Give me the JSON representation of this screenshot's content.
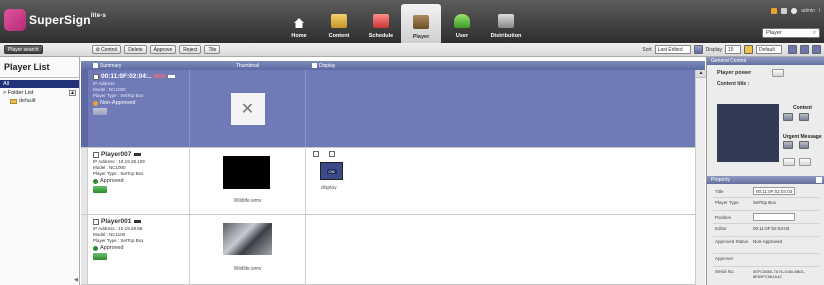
{
  "logo": {
    "text": "SuperSign",
    "suffix": "lite-s"
  },
  "nav": [
    {
      "label": "Home",
      "icon": "home-icon"
    },
    {
      "label": "Content",
      "icon": "content-icon"
    },
    {
      "label": "Schedule",
      "icon": "schedule-icon"
    },
    {
      "label": "Player",
      "icon": "player-icon"
    },
    {
      "label": "User",
      "icon": "user-icon"
    },
    {
      "label": "Distribution",
      "icon": "distribution-icon"
    }
  ],
  "header_right": {
    "user": "admin",
    "search_value": "Player"
  },
  "toolbar": {
    "player_search": "Player search",
    "control": "Control",
    "delete": "Delete",
    "approve": "Approve",
    "reject": "Reject",
    "tile": "Tile",
    "sort_label": "Sort",
    "sort_value": "Last Edited",
    "display_label": "Display",
    "display_value": "15",
    "view_value": "Default"
  },
  "sidebar": {
    "title": "Player List",
    "all": "All",
    "folder_list": "> Folder List",
    "folder_default": "default"
  },
  "columns": {
    "summary": "Summary",
    "thumbnail": "Thumbnail",
    "display": "Display"
  },
  "players": [
    {
      "name": "00:11:0F:02:04:..",
      "badge": "NEW",
      "ip": "IP Address",
      "model": "Model : NC1000",
      "type": "Player Type : SetTop Box",
      "status": "Non-Approved"
    },
    {
      "name": "Player007",
      "ip": "IP Address : 10.19.28.109",
      "model": "Model : NC1000",
      "type": "Player Type : SetTop Box",
      "status": "Approved",
      "file": "Wildlife.wmv",
      "display_label": "display",
      "display_button": "ON"
    },
    {
      "name": "Player001",
      "ip": "IP Address : 10.19.28.86",
      "model": "Model : NC1100",
      "type": "Player Type : SetTop Box",
      "status": "Approved",
      "file": "Wildlife.wmv"
    }
  ],
  "panel": {
    "general_control": "General Control",
    "player_power": "Player power",
    "content_title": "Content title :",
    "content": "Content",
    "urgent_message": "Urgent Message",
    "property": "Property",
    "props": [
      {
        "key": "Title",
        "value": "00:11:0F:02:04:03"
      },
      {
        "key": "Player Type",
        "value": "SetTop Box"
      },
      {
        "key": "Position",
        "value": ""
      },
      {
        "key": "Editor",
        "value": "00:11:0F:02:04:03"
      },
      {
        "key": "Approved Status",
        "value": "Non-Approved"
      },
      {
        "key": "Approver",
        "value": ""
      },
      {
        "key": "Serial No.",
        "value": "0EFC5080-7A76-1060-8B01-8E59FC961A1C"
      }
    ]
  },
  "colors": {
    "accent": "#6f7ab7",
    "header": "#3a3a3a",
    "approved": "#2e8a2e",
    "nonapproved": "#f0a030"
  }
}
